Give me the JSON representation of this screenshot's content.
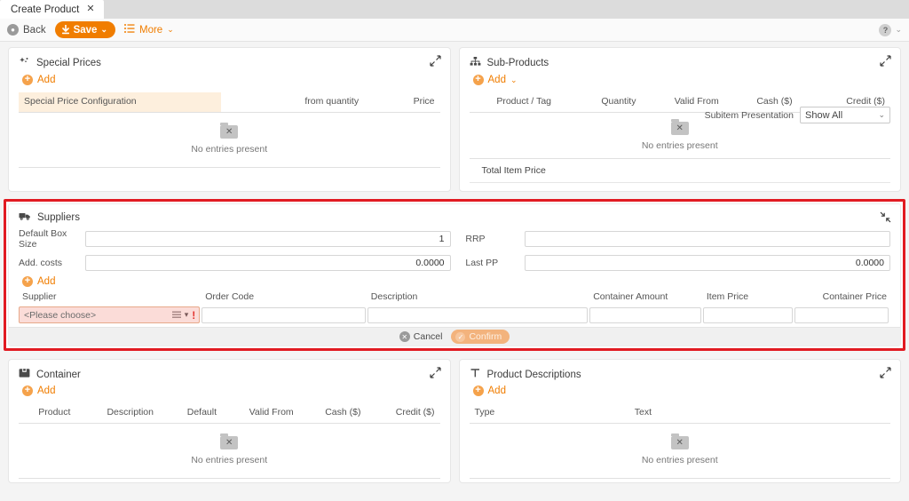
{
  "tab": {
    "title": "Create Product",
    "close_icon": "close-icon",
    "close_label": "✕"
  },
  "toolbar": {
    "back_label": "Back",
    "save_label": "Save",
    "more_label": "More",
    "caret": "⌄",
    "help_label": "?",
    "help_caret": "⌄"
  },
  "special_prices": {
    "title": "Special Prices",
    "add_label": "Add",
    "columns": [
      "Special Price Configuration",
      "from quantity",
      "Price"
    ],
    "empty_text": "No entries present",
    "empty_icon": "✕"
  },
  "sub_products": {
    "title": "Sub-Products",
    "add_label": "Add",
    "add_caret": "⌄",
    "subitem_label": "Subitem Presentation",
    "subitem_value": "Show All",
    "subitem_caret": "⌄",
    "columns": [
      "Product / Tag",
      "Quantity",
      "Valid From",
      "Cash ($)",
      "Credit ($)"
    ],
    "empty_text": "No entries present",
    "empty_icon": "✕",
    "total_label": "Total Item Price"
  },
  "suppliers": {
    "title": "Suppliers",
    "highlight_color": "#e11b22",
    "fields": [
      {
        "label": "Default Box Size",
        "value": "1"
      },
      {
        "label": "RRP",
        "value": ""
      },
      {
        "label": "Add. costs",
        "value": "0.0000"
      },
      {
        "label": "Last PP",
        "value": "0.0000"
      }
    ],
    "add_label": "Add",
    "columns": [
      "Supplier",
      "Order Code",
      "Description",
      "Container Amount",
      "Item Price",
      "Container Price"
    ],
    "row": {
      "supplier_placeholder": "<Please choose>",
      "supplier_value": "",
      "order_code": "",
      "description": "",
      "container_amount": "",
      "item_price": "",
      "container_price": "",
      "warning_icon": "!"
    },
    "cancel_label": "Cancel",
    "confirm_label": "Confirm"
  },
  "container": {
    "title": "Container",
    "add_label": "Add",
    "columns": [
      "Product",
      "Description",
      "Default",
      "Valid From",
      "Cash ($)",
      "Credit ($)"
    ],
    "empty_text": "No entries present",
    "empty_icon": "✕"
  },
  "product_descriptions": {
    "title": "Product Descriptions",
    "add_label": "Add",
    "columns": [
      "Type",
      "Text"
    ],
    "empty_text": "No entries present",
    "empty_icon": "✕"
  }
}
